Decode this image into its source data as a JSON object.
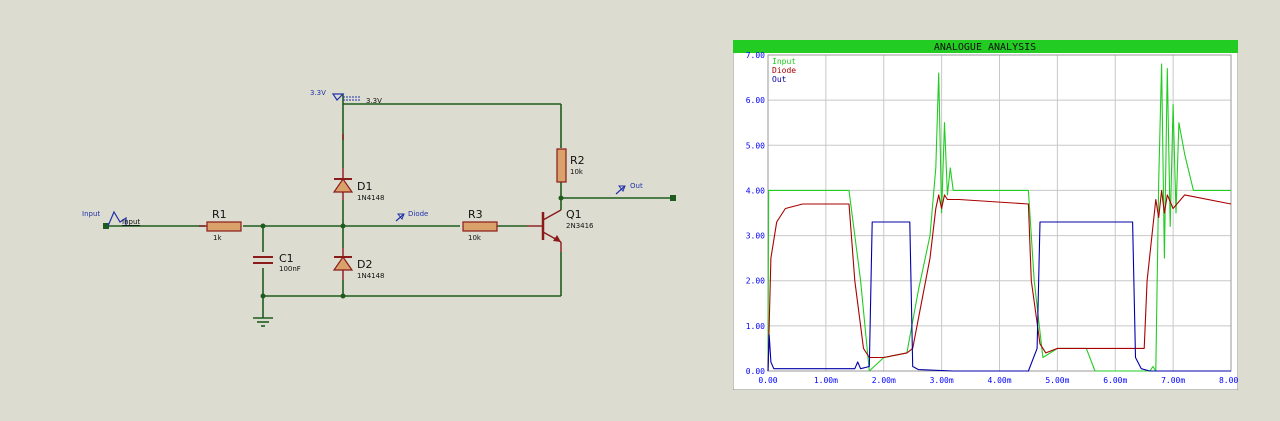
{
  "schematic": {
    "input_terminal": "Input",
    "input_net": "Input",
    "supply_terminal": "3.3V",
    "supply_net": "3.3V",
    "diode_probe": "Diode",
    "out_probe": "Out",
    "r1": {
      "ref": "R1",
      "value": "1k"
    },
    "r2": {
      "ref": "R2",
      "value": "10k"
    },
    "r3": {
      "ref": "R3",
      "value": "10k"
    },
    "c1": {
      "ref": "C1",
      "value": "100nF"
    },
    "d1": {
      "ref": "D1",
      "value": "1N4148"
    },
    "d2": {
      "ref": "D2",
      "value": "1N4148"
    },
    "q1": {
      "ref": "Q1",
      "value": "2N3416"
    }
  },
  "graph": {
    "title": "ANALOGUE ANALYSIS",
    "colors": {
      "title_bar": "#22cc22",
      "grid": "#c8c8c8",
      "axis_text": "#0000ff",
      "input": "#22cc22",
      "diode": "#aa0000",
      "out": "#0000aa"
    }
  },
  "chart_data": {
    "type": "line",
    "title": "ANALOGUE ANALYSIS",
    "xlabel": "",
    "ylabel": "",
    "xlim": [
      0,
      8.0
    ],
    "ylim": [
      0,
      7.0
    ],
    "x_tick_labels": [
      "0.00",
      "1.00m",
      "2.00m",
      "3.00m",
      "4.00m",
      "5.00m",
      "6.00m",
      "7.00m",
      "8.00m"
    ],
    "y_tick_labels": [
      "0.00",
      "1.00",
      "2.00",
      "3.00",
      "4.00",
      "5.00",
      "6.00",
      "7.00"
    ],
    "legend_position": "top-left",
    "grid": true,
    "series": [
      {
        "name": "Input",
        "color": "#22cc22",
        "x": [
          0,
          0.01,
          1.4,
          1.6,
          1.75,
          2.0,
          2.4,
          2.6,
          2.8,
          2.9,
          2.95,
          3.0,
          3.05,
          3.1,
          3.15,
          3.2,
          3.3,
          4.5,
          4.6,
          4.75,
          5.0,
          5.5,
          5.65,
          5.9,
          6.5,
          6.6,
          6.65,
          6.7,
          6.75,
          6.8,
          6.85,
          6.9,
          6.95,
          7.0,
          7.05,
          7.1,
          7.2,
          7.35,
          8.0
        ],
        "y": [
          0.0,
          4.0,
          4.0,
          2.0,
          0.0,
          0.3,
          0.4,
          1.8,
          3.0,
          4.5,
          6.6,
          3.5,
          5.5,
          3.9,
          4.5,
          4.0,
          4.0,
          4.0,
          2.0,
          0.3,
          0.5,
          0.5,
          0.0,
          0.0,
          0.0,
          0.0,
          0.1,
          0.0,
          4.2,
          6.8,
          2.5,
          6.7,
          3.2,
          5.9,
          3.5,
          5.5,
          4.8,
          4.0,
          4.0
        ]
      },
      {
        "name": "Diode",
        "color": "#aa0000",
        "x": [
          0,
          0.05,
          0.15,
          0.3,
          0.6,
          1.4,
          1.5,
          1.65,
          1.75,
          2.0,
          2.4,
          2.5,
          2.8,
          2.9,
          2.95,
          3.0,
          3.05,
          3.1,
          3.3,
          4.5,
          4.55,
          4.7,
          4.8,
          5.0,
          5.5,
          6.5,
          6.55,
          6.7,
          6.75,
          6.8,
          6.85,
          6.9,
          7.0,
          7.2,
          8.0
        ],
        "y": [
          0.0,
          2.5,
          3.3,
          3.6,
          3.7,
          3.7,
          2.0,
          0.5,
          0.3,
          0.3,
          0.4,
          0.5,
          2.5,
          3.6,
          3.9,
          3.6,
          3.9,
          3.8,
          3.8,
          3.7,
          2.0,
          0.6,
          0.4,
          0.5,
          0.5,
          0.5,
          2.0,
          3.8,
          3.4,
          4.0,
          3.5,
          3.9,
          3.6,
          3.9,
          3.7
        ]
      },
      {
        "name": "Out",
        "color": "#0000aa",
        "x": [
          0,
          0.02,
          0.05,
          0.1,
          1.5,
          1.55,
          1.6,
          1.75,
          1.8,
          2.45,
          2.5,
          2.6,
          3.2,
          4.5,
          4.65,
          4.7,
          4.8,
          6.3,
          6.35,
          6.45,
          6.6,
          8.0
        ],
        "y": [
          0.0,
          0.8,
          0.2,
          0.05,
          0.05,
          0.2,
          0.05,
          0.1,
          3.3,
          3.3,
          0.1,
          0.03,
          0.0,
          0.0,
          0.5,
          3.3,
          3.3,
          3.3,
          0.3,
          0.05,
          0.0,
          0.0
        ]
      }
    ]
  }
}
